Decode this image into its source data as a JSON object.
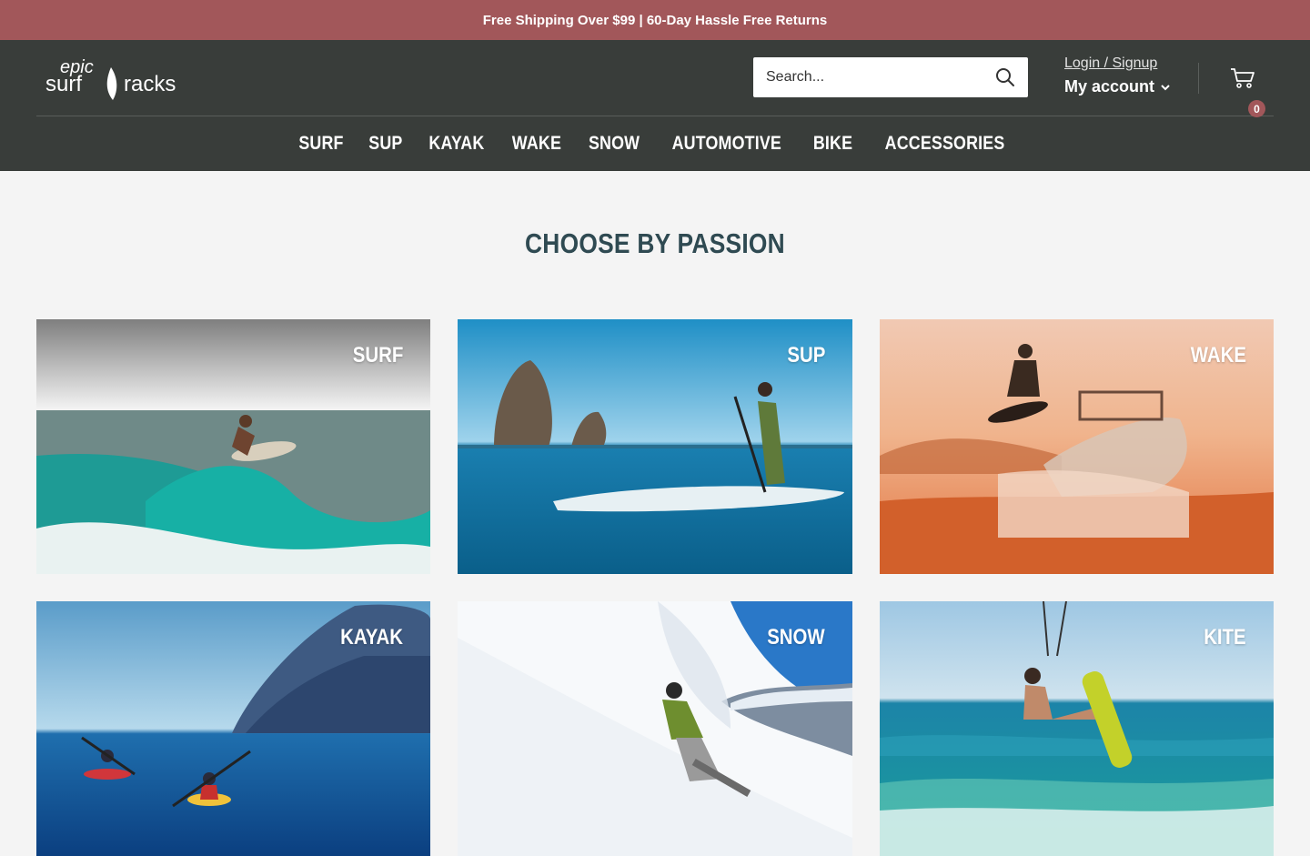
{
  "announcement": "Free Shipping Over $99 | 60-Day Hassle Free Returns",
  "brand": {
    "logo_text_1": "epic",
    "logo_text_2": "surf",
    "logo_text_3": "racks"
  },
  "search": {
    "placeholder": "Search..."
  },
  "account": {
    "login_label": "Login / Signup",
    "my_account_label": "My account"
  },
  "cart": {
    "count": "0"
  },
  "nav": {
    "items": [
      "SURF",
      "SUP",
      "KAYAK",
      "WAKE",
      "SNOW",
      "AUTOMOTIVE",
      "BIKE",
      "ACCESSORIES"
    ]
  },
  "section": {
    "title": "CHOOSE BY PASSION"
  },
  "tiles": [
    {
      "label": "SURF"
    },
    {
      "label": "SUP"
    },
    {
      "label": "WAKE"
    },
    {
      "label": "KAYAK"
    },
    {
      "label": "SNOW"
    },
    {
      "label": "KITE"
    }
  ],
  "colors": {
    "announce": "#a2575a",
    "header": "#393d3a",
    "title": "#2f4a52",
    "page": "#f4f4f4"
  }
}
